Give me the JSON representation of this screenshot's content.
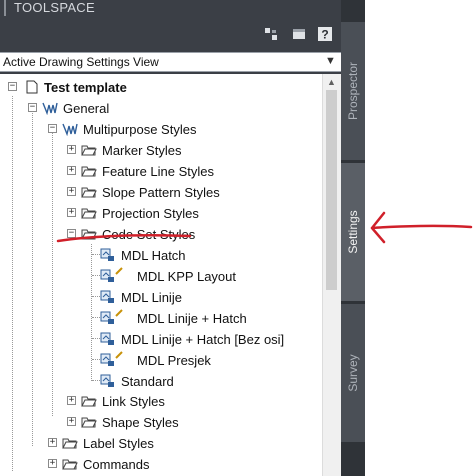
{
  "panel": {
    "title": "TOOLSPACE",
    "toolbar_icons": [
      "item-view-icon",
      "panorama-icon",
      "help-icon"
    ],
    "help_glyph": "?",
    "view_selector": {
      "selected": "Active Drawing Settings View"
    }
  },
  "tree": {
    "root": "Test template",
    "general": "General",
    "multipurpose_styles": "Multipurpose Styles",
    "marker_styles": "Marker Styles",
    "feature_line_styles": "Feature Line Styles",
    "slope_pattern_styles": "Slope Pattern Styles",
    "projection_styles": "Projection Styles",
    "code_set_styles": "Code Set Styles",
    "code_sets": [
      "MDL Hatch",
      "MDL KPP Layout",
      "MDL Linije",
      "MDL Linije + Hatch",
      "MDL Linije + Hatch [Bez osi]",
      "MDL Presjek",
      "Standard"
    ],
    "link_styles": "Link Styles",
    "shape_styles": "Shape Styles",
    "label_styles": "Label Styles",
    "commands": "Commands"
  },
  "tabs": {
    "prospector": "Prospector",
    "settings": "Settings",
    "survey": "Survey",
    "active": "Settings"
  },
  "colors": {
    "panel_bg": "#3b3f46",
    "annotation_red": "#d0202a"
  }
}
